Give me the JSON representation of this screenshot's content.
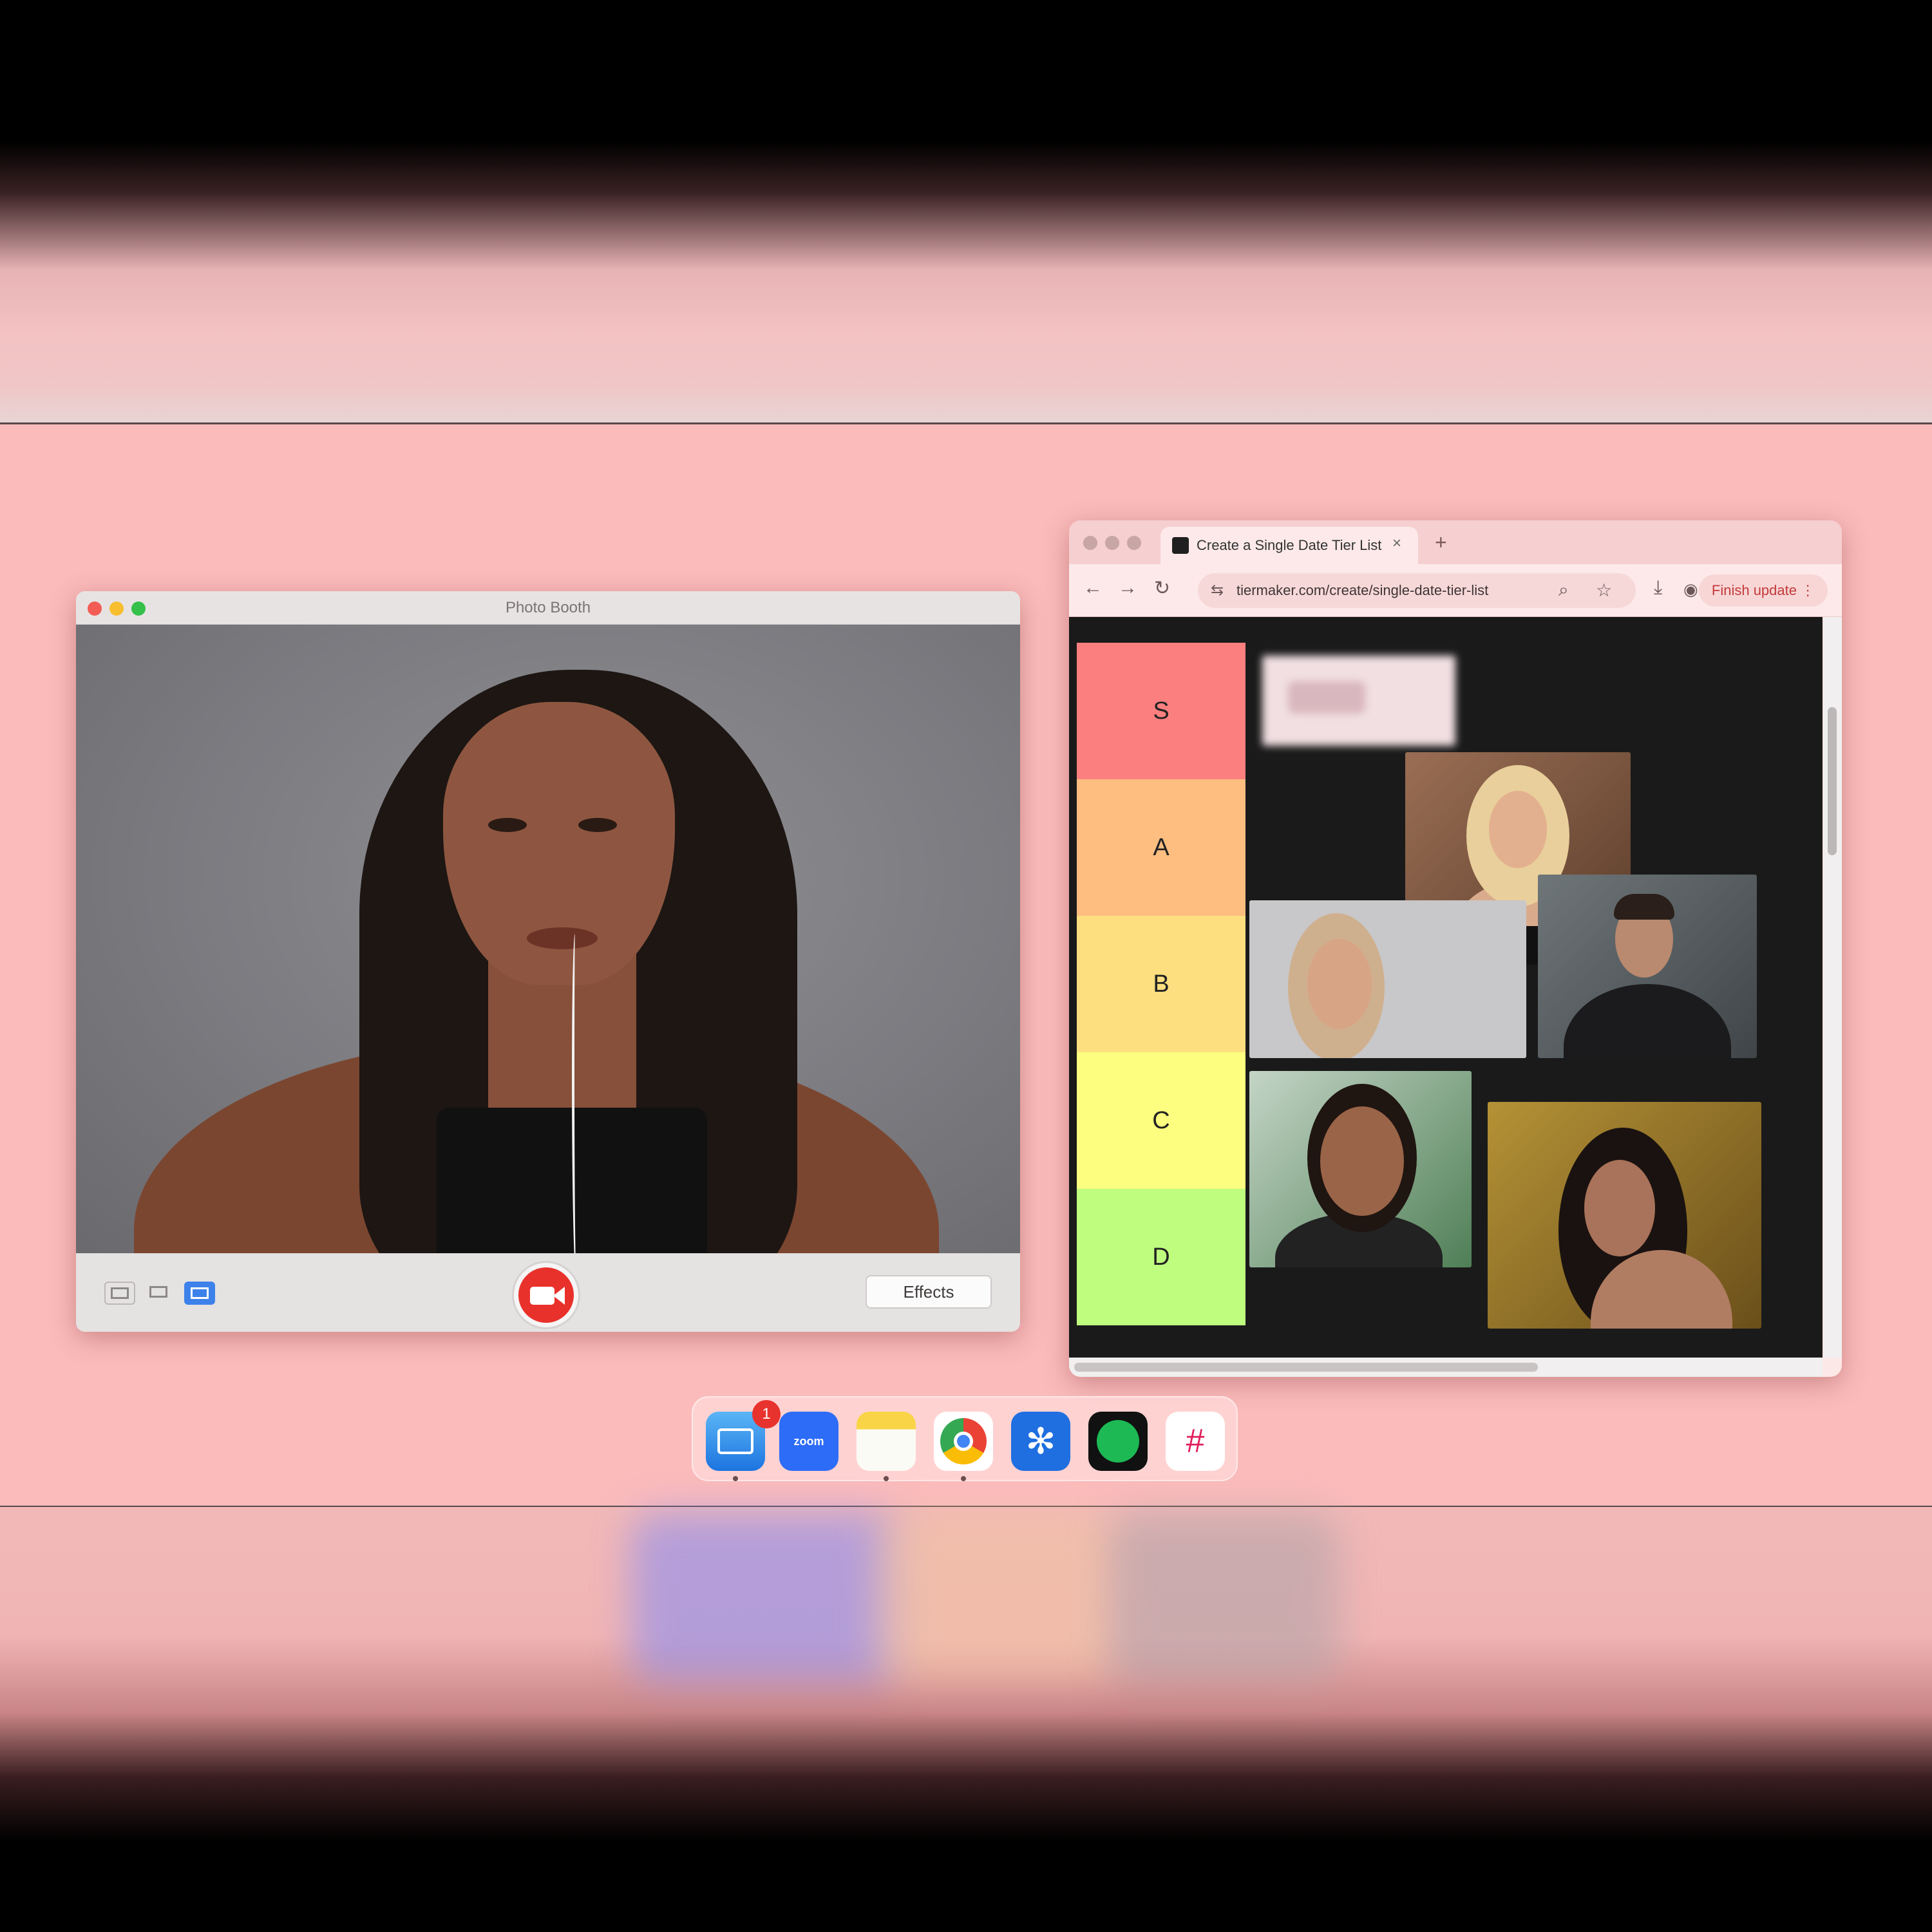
{
  "photo_booth": {
    "title": "Photo Booth",
    "effects_label": "Effects",
    "layout_buttons": [
      "grid-view",
      "single-view",
      "strip-view"
    ],
    "active_layout": "strip-view"
  },
  "browser": {
    "tab_title": "Create a Single Date Tier List",
    "new_tab": "+",
    "tab_close": "×",
    "url": "tiermaker.com/create/single-date-tier-list",
    "update_button": "Finish update",
    "menu": "⋮"
  },
  "tier_list": {
    "tiers": [
      {
        "label": "S",
        "color": "#fc7f7f"
      },
      {
        "label": "A",
        "color": "#fdbe80"
      },
      {
        "label": "B",
        "color": "#fddf80"
      },
      {
        "label": "C",
        "color": "#fdfd7f"
      },
      {
        "label": "D",
        "color": "#bffd7f"
      }
    ]
  },
  "dock": {
    "apps": [
      {
        "name": "Mail",
        "icon": "mail-icon",
        "badge": "1"
      },
      {
        "name": "Zoom",
        "icon": "zoom-icon",
        "label": "zoom"
      },
      {
        "name": "Notes",
        "icon": "notes-icon"
      },
      {
        "name": "Chrome",
        "icon": "chrome-icon"
      },
      {
        "name": "Settings",
        "icon": "settings-icon"
      },
      {
        "name": "Spotify",
        "icon": "spotify-icon"
      },
      {
        "name": "Slack",
        "icon": "slack-icon"
      }
    ]
  },
  "colors": {
    "desktop": "#fbbbbb",
    "record": "#e9312b",
    "accent": "#3d82ea"
  }
}
